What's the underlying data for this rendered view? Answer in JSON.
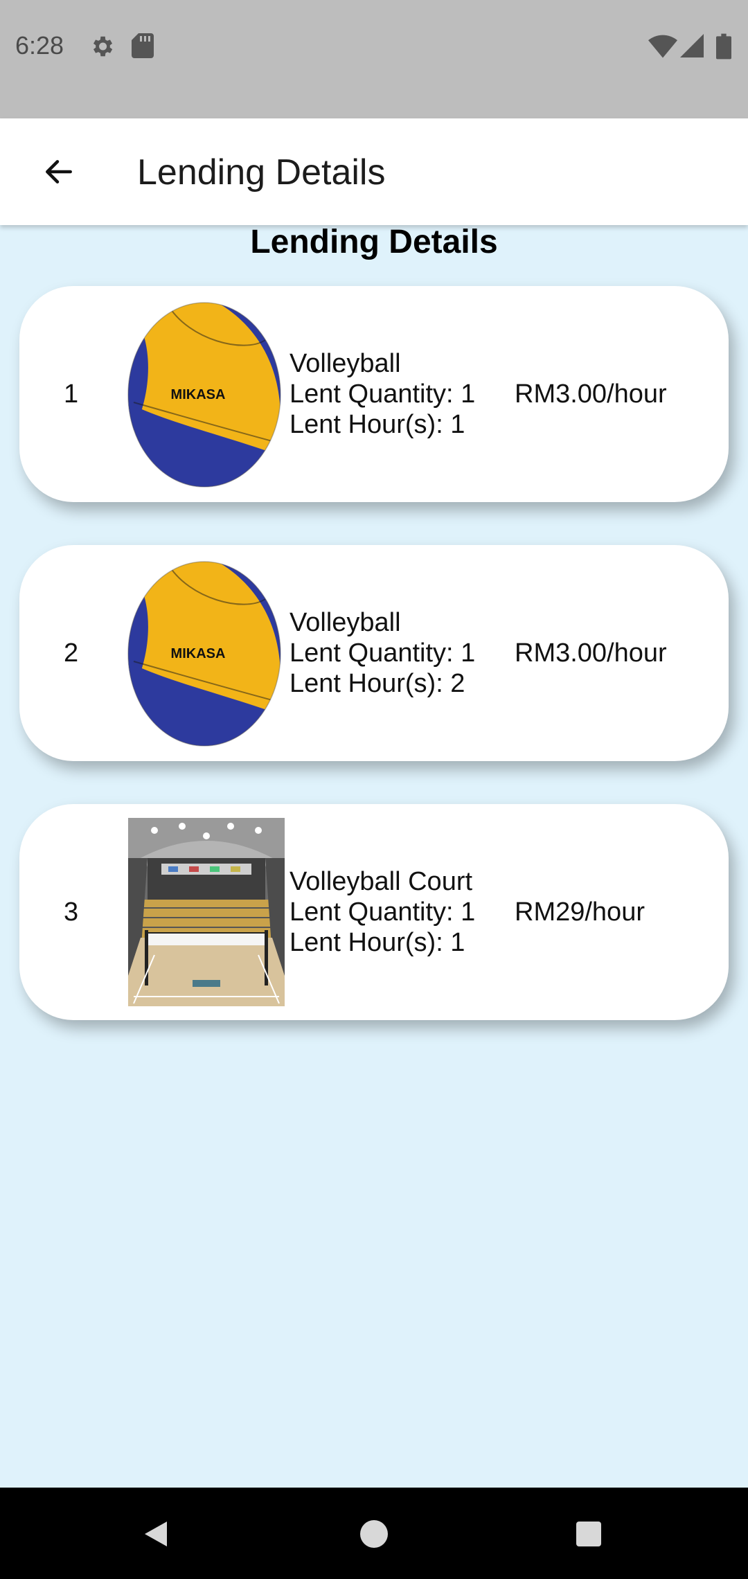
{
  "status_bar": {
    "time": "6:28",
    "icons_left": [
      "gear-icon",
      "sd-card-icon"
    ],
    "icons_right": [
      "wifi-icon",
      "signal-icon",
      "battery-icon"
    ]
  },
  "app_bar": {
    "title": "Lending Details",
    "back_icon": "arrow-back-icon"
  },
  "page": {
    "heading": "Lending Details"
  },
  "items": [
    {
      "index": "1",
      "image": "volleyball-image",
      "name": "Volleyball",
      "quantity": "Lent Quantity: 1",
      "hours": "Lent Hour(s): 1",
      "price": "RM3.00/hour"
    },
    {
      "index": "2",
      "image": "volleyball-image",
      "name": "Volleyball",
      "quantity": "Lent Quantity: 1",
      "hours": "Lent Hour(s): 2",
      "price": "RM3.00/hour"
    },
    {
      "index": "3",
      "image": "volleyball-court-image",
      "name": "Volleyball Court",
      "quantity": "Lent Quantity: 1",
      "hours": "Lent Hour(s): 1",
      "price": "RM29/hour"
    }
  ],
  "nav_bar": {
    "buttons": [
      "back-triangle-icon",
      "home-circle-icon",
      "recents-square-icon"
    ]
  },
  "colors": {
    "background": "#dff2fb",
    "status_bar": "#bdbdbd",
    "app_bar": "#ffffff",
    "card": "#ffffff",
    "ball_yellow": "#f2b418",
    "ball_blue": "#2d3a9e"
  }
}
